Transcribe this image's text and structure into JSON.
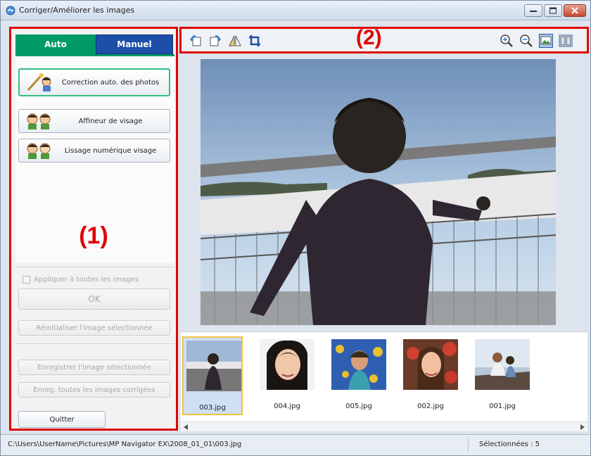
{
  "window": {
    "title": "Corriger/Améliorer les images",
    "minimize_icon": "minimize-icon",
    "maximize_icon": "maximize-icon",
    "close_icon": "close-icon"
  },
  "left_panel": {
    "label": "(1)",
    "tabs": [
      {
        "label": "Auto",
        "active": true
      },
      {
        "label": "Manuel",
        "active": false
      }
    ],
    "buttons": [
      {
        "label": "Correction auto. des photos",
        "icon": "auto-photo-fix-icon"
      },
      {
        "label": "Affineur de visage",
        "icon": "face-sharpener-icon"
      },
      {
        "label": "Lissage numérique visage",
        "icon": "digital-face-smoothing-icon"
      }
    ],
    "apply_all_label": "Appliquer à toutes les images",
    "ok_label": "OK",
    "reset_label": "Réinitialiser l'image sélectionnée",
    "save_selected_label": "Enregistrer l'image sélectionnée",
    "save_all_label": "Enreg. toutes les images corrigées",
    "quit_label": "Quitter"
  },
  "toolbar": {
    "label": "(2)",
    "left_icons": [
      "rotate-left-icon",
      "rotate-right-icon",
      "flip-icon",
      "crop-icon"
    ],
    "right_icons": [
      "zoom-in-icon",
      "zoom-out-icon",
      "full-screen-view-icon",
      "compare-view-icon"
    ]
  },
  "thumbnails": [
    {
      "label": "003.jpg",
      "selected": true
    },
    {
      "label": "004.jpg",
      "selected": false
    },
    {
      "label": "005.jpg",
      "selected": false
    },
    {
      "label": "002.jpg",
      "selected": false
    },
    {
      "label": "001.jpg",
      "selected": false
    }
  ],
  "status": {
    "path": "C:\\Users\\UserName\\Pictures\\MP Navigator EX\\2008_01_01\\003.jpg",
    "selected": "Sélectionnées : 5"
  }
}
